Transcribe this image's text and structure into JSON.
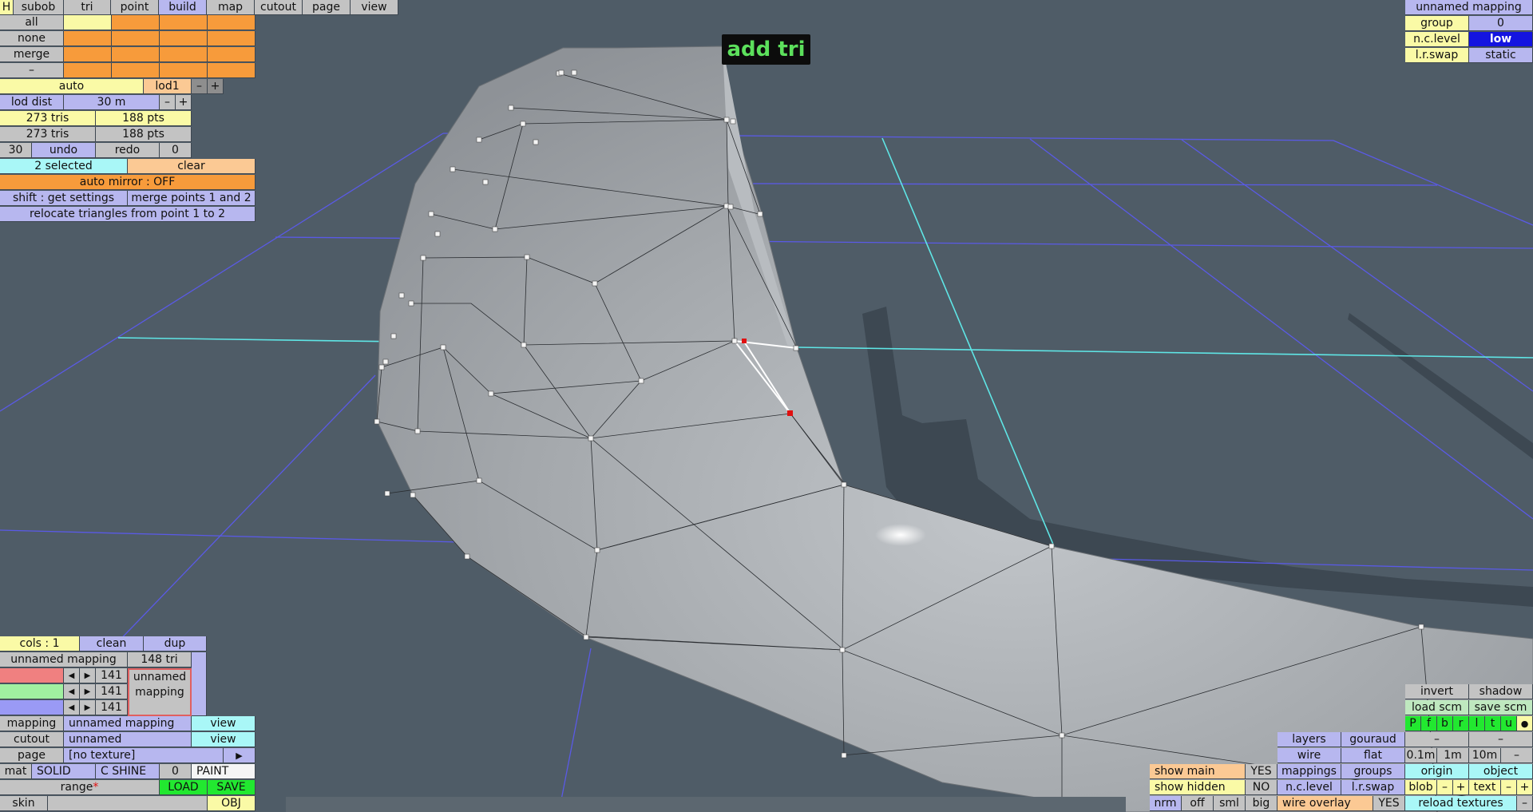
{
  "tool_label": "add tri",
  "top_menu": [
    "H",
    "subob",
    "tri",
    "point",
    "build",
    "map",
    "cutout",
    "page",
    "view"
  ],
  "select_rows": [
    "all",
    "none",
    "merge",
    "–"
  ],
  "lod": {
    "auto": "auto",
    "lod1": "lod1",
    "minus": "–",
    "plus": "+",
    "dist_label": "lod dist",
    "dist_value": "30 m"
  },
  "stats": {
    "tris1": "273 tris",
    "pts1": "188 pts",
    "tris2": "273 tris",
    "pts2": "188 pts"
  },
  "history": {
    "count": "30",
    "undo": "undo",
    "redo": "redo",
    "redo_count": "0"
  },
  "selection": {
    "selected": "2 selected",
    "clear": "clear",
    "auto_mirror": "auto mirror : OFF",
    "shift_settings": "shift : get settings",
    "merge_points": "merge points 1 and 2",
    "relocate": "relocate triangles from point 1 to 2"
  },
  "top_right": {
    "mapping_title": "unnamed mapping",
    "group_label": "group",
    "group_value": "0",
    "nclevel_label": "n.c.level",
    "nclevel_value": "low",
    "lrswap_label": "l.r.swap",
    "lrswap_value": "static"
  },
  "bottom_left": {
    "cols": "cols : 1",
    "clean": "clean",
    "dup": "dup",
    "mapping_name": "unnamed mapping",
    "tri_count": "148 tri",
    "channels": [
      "141",
      "141",
      "141"
    ],
    "preview_line1": "unnamed",
    "preview_line2": "mapping",
    "mapping_label": "mapping",
    "mapping_value": "unnamed mapping",
    "cutout_label": "cutout",
    "cutout_value": "unnamed",
    "view": "view",
    "page_label": "page",
    "page_value": "[no texture]",
    "page_arrow": "▶",
    "mat": "mat",
    "solid": "SOLID",
    "cshine": "C SHINE",
    "mat_count": "0",
    "paint": "PAINT",
    "range": "range",
    "range_mark": "*",
    "load": "LOAD",
    "save": "SAVE",
    "skin": "skin",
    "obj": "OBJ"
  },
  "bottom_right": {
    "invert": "invert",
    "shadow": "shadow",
    "load_scm": "load scm",
    "save_scm": "save scm",
    "view_letters": [
      "P",
      "f",
      "b",
      "r",
      "l",
      "t",
      "u"
    ],
    "dot": "●",
    "layers": "layers",
    "gouraud": "gouraud",
    "dash1": "–",
    "dash2": "–",
    "wire": "wire",
    "flat": "flat",
    "d01": "0.1m",
    "d1": "1m",
    "d10": "10m",
    "dminus": "–",
    "show_main": "show main",
    "show_main_val": "YES",
    "mappings": "mappings",
    "groups": "groups",
    "origin": "origin",
    "object": "object",
    "show_hidden": "show hidden",
    "show_hidden_val": "NO",
    "nclevel": "n.c.level",
    "lrswap": "l.r.swap",
    "blob": "blob",
    "blob_minus": "–",
    "blob_plus": "+",
    "text": "text",
    "text_minus": "–",
    "text_plus": "+",
    "nrm": "nrm",
    "off": "off",
    "sml": "sml",
    "big": "big",
    "wire_overlay": "wire overlay",
    "wire_overlay_val": "YES",
    "reload": "reload textures",
    "reload_minus": "–"
  },
  "colors": {
    "background": "#4f5c67",
    "mesh": "#a9adb1",
    "grid": "#5a5ae6",
    "axis": "#5fe6e6",
    "selected_point": "#e01010"
  }
}
